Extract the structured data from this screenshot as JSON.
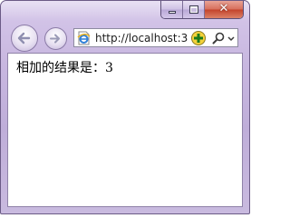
{
  "browser": {
    "address": {
      "url": "http://localhost:3"
    },
    "icons": {
      "back": "back-arrow-icon",
      "forward": "forward-arrow-icon",
      "page": "ie-page-icon",
      "compatibility": "compatibility-view-icon",
      "search": "search-icon",
      "dropdown": "chevron-down-icon",
      "minimize": "minimize-icon",
      "maximize": "maximize-icon",
      "close": "close-icon"
    },
    "caption": {
      "close_symbol": "✕"
    }
  },
  "page": {
    "result_text": "相加的结果是：3"
  },
  "colors": {
    "frame": "#c8b7e0",
    "close_button": "#c3432b",
    "content_bg": "#ffffff"
  }
}
